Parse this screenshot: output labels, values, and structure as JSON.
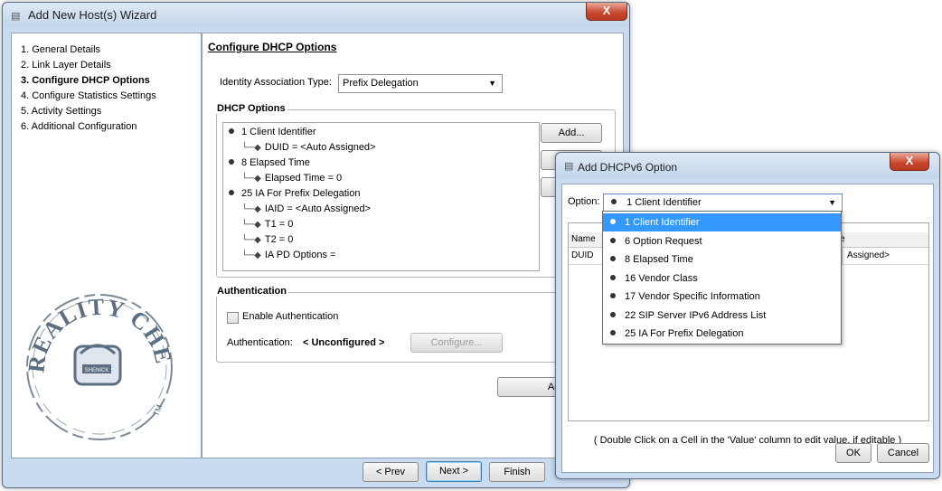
{
  "wizard": {
    "title": "Add New Host(s) Wizard",
    "close_symbol": "X",
    "nav_items": [
      {
        "label": "1. General Details",
        "bold": false
      },
      {
        "label": "2. Link Layer Details",
        "bold": false
      },
      {
        "label": "3. Configure DHCP Options",
        "bold": true
      },
      {
        "label": "4. Configure Statistics Settings",
        "bold": false
      },
      {
        "label": "5. Activity Settings",
        "bold": false
      },
      {
        "label": "6. Additional Configuration",
        "bold": false
      }
    ],
    "logo_text": "REALITY CHECKED",
    "logo_badge": "SHENICK",
    "logo_tm": "TM",
    "section_title": "Configure DHCP Options",
    "ia_type_label": "Identity Association Type:",
    "ia_type_value": "Prefix Delegation",
    "dhcp_options_group": "DHCP Options",
    "tree": [
      {
        "text": "1 Client Identifier",
        "level": 0
      },
      {
        "text": "DUID = <Auto Assigned>",
        "level": 1
      },
      {
        "text": "8 Elapsed Time",
        "level": 0
      },
      {
        "text": "Elapsed Time = 0",
        "level": 1
      },
      {
        "text": "25 IA For Prefix Delegation",
        "level": 0
      },
      {
        "text": "IAID = <Auto Assigned>",
        "level": 1
      },
      {
        "text": "T1 = 0",
        "level": 1
      },
      {
        "text": "T2 = 0",
        "level": 1
      },
      {
        "text": "IA PD Options =",
        "level": 1
      }
    ],
    "add_button": "Add...",
    "auth_group": "Authentication",
    "enable_auth_label": "Enable Authentication",
    "auth_status_label": "Authentication:",
    "auth_status_value": "< Unconfigured >",
    "configure_button": "Configure...",
    "advanced_button": "Adva",
    "prev_button": "< Prev",
    "next_button": "Next >",
    "finish_button": "Finish"
  },
  "dialog": {
    "title": "Add DHCPv6 Option",
    "close_symbol": "X",
    "option_label": "Option:",
    "option_value": "1 Client Identifier",
    "dropdown_options": [
      "1 Client Identifier",
      "6 Option Request",
      "8 Elapsed Time",
      "16 Vendor Class",
      "17 Vendor Specific Information",
      "22 SIP Server IPv6 Address List",
      "25 IA For Prefix Delegation"
    ],
    "selected_index": 0,
    "table_headers": [
      "Name",
      "e"
    ],
    "table_rows": [
      [
        "DUID",
        "Assigned>"
      ]
    ],
    "hint": "( Double Click on a Cell in the 'Value' column to edit value, if editable )",
    "ok_button": "OK",
    "cancel_button": "Cancel"
  },
  "colors": {
    "selection": "#3399ff",
    "frame": "#c9dbee",
    "close_red": "#c7452d"
  }
}
